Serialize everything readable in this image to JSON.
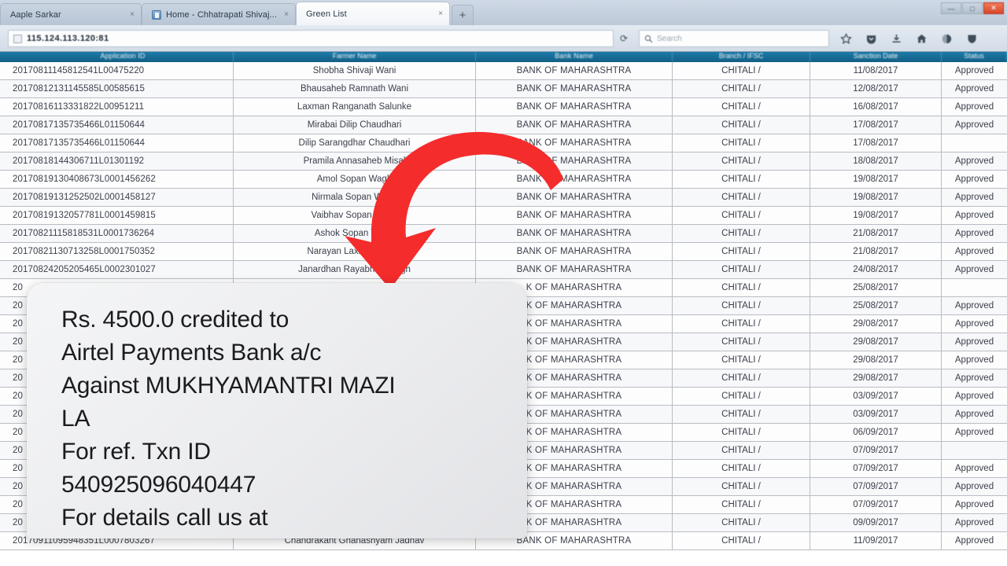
{
  "browser": {
    "tabs": [
      {
        "label": "Aaple Sarkar",
        "close": "×",
        "favicon": false,
        "active": false
      },
      {
        "label": "Home - Chhatrapati Shivaj...",
        "close": "×",
        "favicon": true,
        "active": false
      },
      {
        "label": "Green List",
        "close": "×",
        "favicon": false,
        "active": true
      }
    ],
    "new_tab_label": "+",
    "window_controls": {
      "minimize": "—",
      "maximize": "□",
      "close": "✕"
    },
    "url": "115.124.113.120:81",
    "reload_icon": "⟳",
    "search": {
      "placeholder": "Search",
      "icon": "search-icon"
    },
    "toolbar_icons": [
      "bookmark-star-icon",
      "pocket-icon",
      "download-icon",
      "home-icon",
      "shield-circle-icon",
      "protection-shield-icon"
    ]
  },
  "table": {
    "columns": [
      "Application ID",
      "Farmer Name",
      "Bank Name",
      "Branch / IFSC",
      "Sanction Date",
      "Status"
    ],
    "rows": [
      {
        "id": "20170811145812541L00475220",
        "name": "Shobha Shivaji Wani",
        "bank": "BANK OF MAHARASHTRA",
        "branch": "CHITALI /",
        "date": "11/08/2017",
        "status": "Approved"
      },
      {
        "id": "20170812131145585L00585615",
        "name": "Bhausaheb Ramnath Wani",
        "bank": "BANK OF MAHARASHTRA",
        "branch": "CHITALI /",
        "date": "12/08/2017",
        "status": "Approved"
      },
      {
        "id": "20170816113331822L00951211",
        "name": "Laxman Ranganath Salunke",
        "bank": "BANK OF MAHARASHTRA",
        "branch": "CHITALI /",
        "date": "16/08/2017",
        "status": "Approved"
      },
      {
        "id": "20170817135735466L01150644",
        "name": "Mirabai Dilip Chaudhari",
        "bank": "BANK OF MAHARASHTRA",
        "branch": "CHITALI /",
        "date": "17/08/2017",
        "status": "Approved"
      },
      {
        "id": "20170817135735466L01150644",
        "name": "Dilip Sarangdhar Chaudhari",
        "bank": "BANK OF MAHARASHTRA",
        "branch": "CHITALI /",
        "date": "17/08/2017",
        "status": ""
      },
      {
        "id": "20170818144306711L01301192",
        "name": "Pramila Annasaheb Misal",
        "bank": "BANK OF MAHARASHTRA",
        "branch": "CHITALI /",
        "date": "18/08/2017",
        "status": "Approved"
      },
      {
        "id": "20170819130408673L0001456262",
        "name": "Amol Sopan Wagh",
        "bank": "BANK OF MAHARASHTRA",
        "branch": "CHITALI /",
        "date": "19/08/2017",
        "status": "Approved"
      },
      {
        "id": "20170819131252502L0001458127",
        "name": "Nirmala Sopan Wagh",
        "bank": "BANK OF MAHARASHTRA",
        "branch": "CHITALI /",
        "date": "19/08/2017",
        "status": "Approved"
      },
      {
        "id": "20170819132057781L0001459815",
        "name": "Vaibhav Sopan Wagh",
        "bank": "BANK OF MAHARASHTRA",
        "branch": "CHITALI /",
        "date": "19/08/2017",
        "status": "Approved"
      },
      {
        "id": "20170821115818531L0001736264",
        "name": "Ashok Sopan Wagh",
        "bank": "BANK OF MAHARASHTRA",
        "branch": "CHITALI /",
        "date": "21/08/2017",
        "status": "Approved"
      },
      {
        "id": "20170821130713258L0001750352",
        "name": "Narayan Laxman Sable",
        "bank": "BANK OF MAHARASHTRA",
        "branch": "CHITALI /",
        "date": "21/08/2017",
        "status": "Approved"
      },
      {
        "id": "20170824205205465L0002301027",
        "name": "Janardhan Rayabhan Wagh",
        "bank": "BANK OF MAHARASHTRA",
        "branch": "CHITALI /",
        "date": "24/08/2017",
        "status": "Approved"
      },
      {
        "id": "20",
        "name": "",
        "bank": "K OF MAHARASHTRA",
        "branch": "CHITALI /",
        "date": "25/08/2017",
        "status": ""
      },
      {
        "id": "20",
        "name": "",
        "bank": "K OF MAHARASHTRA",
        "branch": "CHITALI /",
        "date": "25/08/2017",
        "status": "Approved"
      },
      {
        "id": "20",
        "name": "",
        "bank": "K OF MAHARASHTRA",
        "branch": "CHITALI /",
        "date": "29/08/2017",
        "status": "Approved"
      },
      {
        "id": "20",
        "name": "",
        "bank": "K OF MAHARASHTRA",
        "branch": "CHITALI /",
        "date": "29/08/2017",
        "status": "Approved"
      },
      {
        "id": "20",
        "name": "",
        "bank": "K OF MAHARASHTRA",
        "branch": "CHITALI /",
        "date": "29/08/2017",
        "status": "Approved"
      },
      {
        "id": "20",
        "name": "",
        "bank": "K OF MAHARASHTRA",
        "branch": "CHITALI /",
        "date": "29/08/2017",
        "status": "Approved"
      },
      {
        "id": "20",
        "name": "",
        "bank": "K OF MAHARASHTRA",
        "branch": "CHITALI /",
        "date": "03/09/2017",
        "status": "Approved"
      },
      {
        "id": "20",
        "name": "",
        "bank": "K OF MAHARASHTRA",
        "branch": "CHITALI /",
        "date": "03/09/2017",
        "status": "Approved"
      },
      {
        "id": "20",
        "name": "",
        "bank": "K OF MAHARASHTRA",
        "branch": "CHITALI /",
        "date": "06/09/2017",
        "status": "Approved"
      },
      {
        "id": "20",
        "name": "",
        "bank": "K OF MAHARASHTRA",
        "branch": "CHITALI /",
        "date": "07/09/2017",
        "status": ""
      },
      {
        "id": "20",
        "name": "",
        "bank": "K OF MAHARASHTRA",
        "branch": "CHITALI /",
        "date": "07/09/2017",
        "status": "Approved"
      },
      {
        "id": "20",
        "name": "",
        "bank": "K OF MAHARASHTRA",
        "branch": "CHITALI /",
        "date": "07/09/2017",
        "status": "Approved"
      },
      {
        "id": "20",
        "name": "",
        "bank": "K OF MAHARASHTRA",
        "branch": "CHITALI /",
        "date": "07/09/2017",
        "status": "Approved"
      },
      {
        "id": "20",
        "name": "",
        "bank": "K OF MAHARASHTRA",
        "branch": "CHITALI /",
        "date": "09/09/2017",
        "status": "Approved"
      },
      {
        "id": "20170911095948351L0007803267",
        "name": "Chandrakant Ghanashyam Jadhav",
        "bank": "BANK OF MAHARASHTRA",
        "branch": "CHITALI /",
        "date": "11/09/2017",
        "status": "Approved"
      }
    ]
  },
  "sms_notification": {
    "lines": [
      "Rs. 4500.0 credited to",
      "Airtel Payments Bank a/c",
      "Against MUKHYAMANTRI MAZI",
      "LA",
      "For ref. Txn ID",
      "540925096040447",
      "For details call us at"
    ],
    "amount": "4500.0",
    "bank": "Airtel Payments Bank",
    "scheme": "MUKHYAMANTRI MAZI LA",
    "txn_id": "540925096040447"
  },
  "annotation": {
    "arrow_color": "#f42c2c",
    "arrow_name": "red-curved-down-arrow"
  },
  "colors": {
    "table_header": "#156a93",
    "chrome": "#c9d4e1",
    "status_text": "#3a3f4a"
  }
}
